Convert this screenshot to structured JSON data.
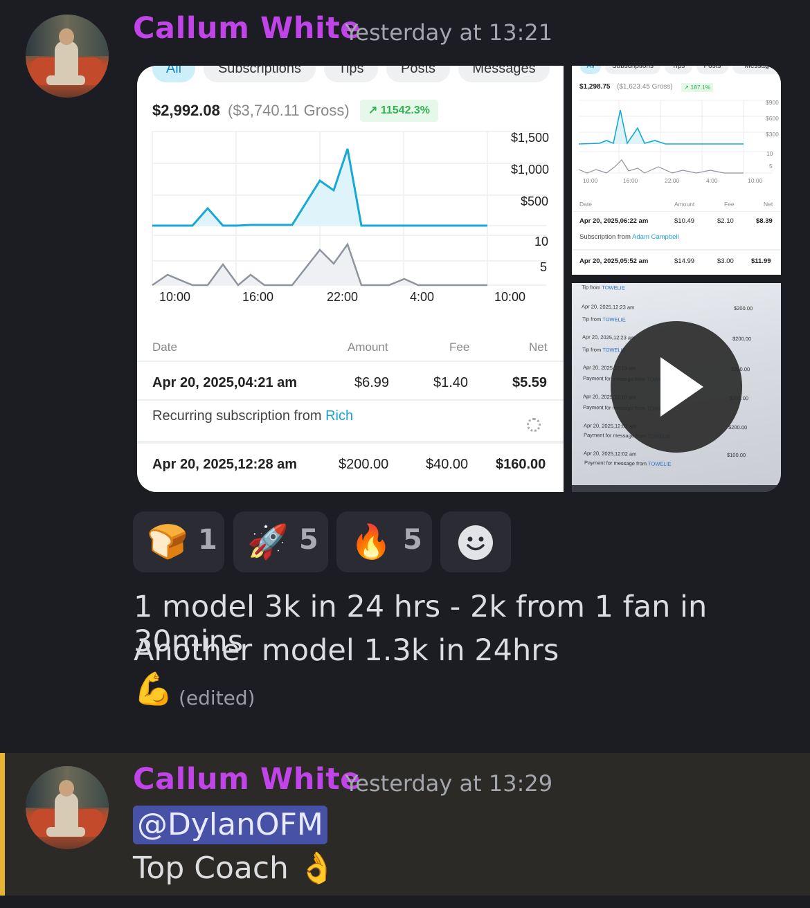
{
  "messages": [
    {
      "author": "Callum White",
      "timestamp": "Yesterday at 13:21",
      "text_line1": "1 model 3k in 24 hrs - 2k from 1 fan in 30mins",
      "text_line2": "Another model 1.3k in 24hrs",
      "emoji_trailing": "💪",
      "edited_label": "(edited)",
      "reactions": [
        {
          "emoji": "🍞",
          "count": "1"
        },
        {
          "emoji": "🚀",
          "count": "5"
        },
        {
          "emoji": "🔥",
          "count": "5"
        },
        {
          "emoji": "add-reaction-icon",
          "count": ""
        }
      ]
    },
    {
      "author": "Callum White",
      "timestamp": "Yesterday at 13:29",
      "mention": "@DylanOFM",
      "text": "Top Coach",
      "emoji_trailing": "👌"
    }
  ],
  "attachment1": {
    "tabs": [
      "All",
      "Subscriptions",
      "Tips",
      "Posts",
      "Messages"
    ],
    "total": "$2,992.08",
    "gross": "($3,740.11 Gross)",
    "change": "↗ 11542.3%",
    "y_ticks_top": [
      "$1,500",
      "$1,000",
      "$500"
    ],
    "y_ticks_bottom": [
      "10",
      "5"
    ],
    "x_ticks": [
      "10:00",
      "16:00",
      "22:00",
      "4:00",
      "10:00"
    ],
    "headers": [
      "Date",
      "Amount",
      "Fee",
      "Net"
    ],
    "rows": [
      {
        "date": "Apr 20, 2025,04:21 am",
        "amount": "$6.99",
        "fee": "$1.40",
        "net": "$5.59",
        "desc": "Recurring subscription from ",
        "from": "Rich"
      },
      {
        "date": "Apr 20, 2025,12:28 am",
        "amount": "$200.00",
        "fee": "$40.00",
        "net": "$160.00"
      }
    ],
    "accent": "#1aa4d4"
  },
  "attachment2": {
    "tabs": [
      "All",
      "Subscriptions",
      "Tips",
      "Posts",
      "Messag"
    ],
    "total": "$1,298.75",
    "gross": "($1,623.45 Gross)",
    "change": "↗ 187.1%",
    "y_ticks_top": [
      "$900",
      "$600",
      "$300"
    ],
    "y_ticks_bottom": [
      "10",
      "5"
    ],
    "x_ticks": [
      "10:00",
      "16:00",
      "22:00",
      "4:00",
      "10:00"
    ],
    "headers": [
      "Date",
      "Amount",
      "Fee",
      "Net"
    ],
    "rows": [
      {
        "date": "Apr 20, 2025,06:22 am",
        "amount": "$10.49",
        "fee": "$2.10",
        "net": "$8.39",
        "desc": "Subscription from ",
        "from": "Adam Campbell"
      },
      {
        "date": "Apr 20, 2025,05:52 am",
        "amount": "$14.99",
        "fee": "$3.00",
        "net": "$11.99"
      }
    ]
  },
  "attachment3": {
    "lines": [
      {
        "t": "Tip from ",
        "l": "TOWELIE",
        "amt": ""
      },
      {
        "t": "Apr 20, 2025,12:23 am",
        "l": "",
        "amt": "$200.00"
      },
      {
        "t": "Tip from ",
        "l": "TOWELIE",
        "amt": ""
      },
      {
        "t": "Apr 20, 2025,12:23 am",
        "l": "",
        "amt": "$200.00"
      },
      {
        "t": "Tip from ",
        "l": "TOWELIE",
        "amt": ""
      },
      {
        "t": "Apr 20, 2025,12:13 am",
        "l": "",
        "amt": "$200.00"
      },
      {
        "t": "Payment for message from ",
        "l": "TOWELIE",
        "amt": ""
      },
      {
        "t": "Apr 20, 2025,12:10 am",
        "l": "",
        "amt": "$200.00"
      },
      {
        "t": "Payment for message from ",
        "l": "TOWELIE",
        "amt": ""
      },
      {
        "t": "Apr 20, 2025,12:07 am",
        "l": "",
        "amt": "$200.00"
      },
      {
        "t": "Payment for message from ",
        "l": "TOWELIE",
        "amt": ""
      },
      {
        "t": "Apr 20, 2025,12:02 am",
        "l": "",
        "amt": "$100.00"
      },
      {
        "t": "Payment for message from ",
        "l": "TOWELIE",
        "amt": ""
      }
    ],
    "play_icon": "play-icon"
  }
}
